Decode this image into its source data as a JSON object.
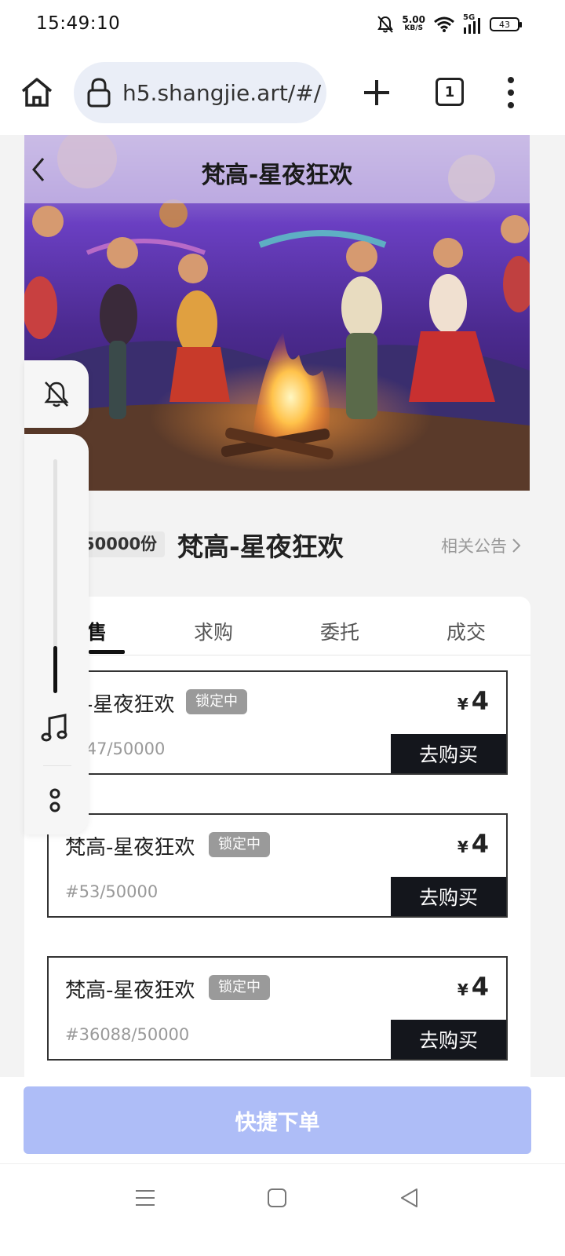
{
  "status_bar": {
    "time": "15:49:10",
    "net_speed_value": "5.00",
    "net_speed_unit": "KB/S",
    "signal_label": "5G",
    "battery": "43",
    "icons": [
      "bell-muted-icon",
      "wifi-icon",
      "cellular-signal-icon",
      "battery-icon"
    ]
  },
  "browser": {
    "url": "h5.shangjie.art/#/",
    "tab_count": "1",
    "icons": [
      "home-icon",
      "lock-icon",
      "plus-icon",
      "tabs-icon",
      "more-vertical-icon"
    ]
  },
  "page": {
    "title": "梵高-星夜狂欢",
    "quantity_badge": "50000份",
    "nft_name": "梵高-星夜狂欢",
    "notice_link": "相关公告",
    "tabs": [
      {
        "label": "售",
        "active": true
      },
      {
        "label": "求购",
        "active": false
      },
      {
        "label": "委托",
        "active": false
      },
      {
        "label": "成交",
        "active": false
      }
    ],
    "listings": [
      {
        "name": "高-星夜狂欢",
        "status": "锁定中",
        "currency": "¥",
        "price": "4",
        "serial": "3647/50000",
        "button": "去购买"
      },
      {
        "name": "梵高-星夜狂欢",
        "status": "锁定中",
        "currency": "¥",
        "price": "4",
        "serial": "#53/50000",
        "button": "去购买"
      },
      {
        "name": "梵高-星夜狂欢",
        "status": "锁定中",
        "currency": "¥",
        "price": "4",
        "serial": "#36088/50000",
        "button": "去购买"
      }
    ],
    "side_panel": {
      "volume_level": 0.2,
      "icons": [
        "bell-muted-icon",
        "music-note-icon",
        "more-dots-icon"
      ]
    },
    "quick_order_label": "快捷下单"
  },
  "colors": {
    "accent_button": "#aebdf7",
    "buy_button": "#14161c",
    "lock_badge": "#9a9a9a"
  },
  "nav": {
    "icons": [
      "menu-icon",
      "home-square-icon",
      "back-triangle-icon"
    ]
  }
}
